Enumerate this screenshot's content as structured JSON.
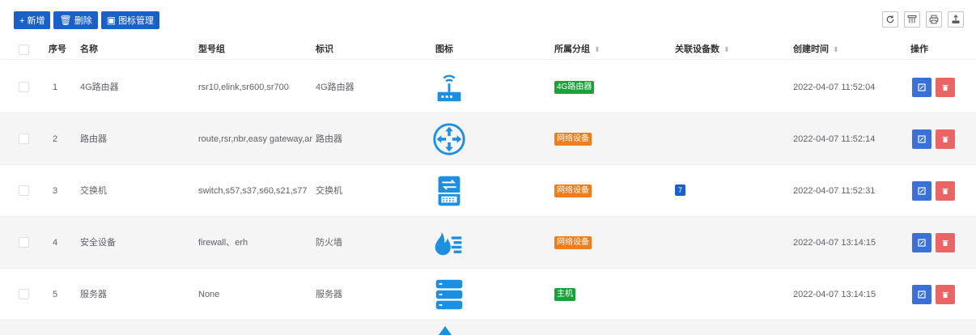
{
  "toolbar": {
    "add_label": "+ 新增",
    "delete_label": "删除",
    "icon_manage_label": "图标管理"
  },
  "table": {
    "headers": {
      "index": "序号",
      "name": "名称",
      "model_group": "型号组",
      "tag": "标识",
      "icon": "图标",
      "group": "所属分组",
      "device_count": "关联设备数",
      "created_at": "创建时间",
      "actions": "操作"
    },
    "rows": [
      {
        "index": "1",
        "name": "4G路由器",
        "model_group": "rsr10,elink,sr600,sr700",
        "tag": "4G路由器",
        "icon": "router-4g-icon",
        "group": "4G路由器",
        "group_color": "#19a23a",
        "device_count": "",
        "created_at": "2022-04-07 11:52:04"
      },
      {
        "index": "2",
        "name": "路由器",
        "model_group": "route,rsr,nbr,easy gateway,ar",
        "tag": "路由器",
        "icon": "router-icon",
        "group": "网络设备",
        "group_color": "#f07d1a",
        "device_count": "",
        "created_at": "2022-04-07 11:52:14"
      },
      {
        "index": "3",
        "name": "交换机",
        "model_group": "switch,s57,s37,s60,s21,s77",
        "tag": "交换机",
        "icon": "switch-icon",
        "group": "网络设备",
        "group_color": "#f07d1a",
        "device_count": "7",
        "created_at": "2022-04-07 11:52:31"
      },
      {
        "index": "4",
        "name": "安全设备",
        "model_group": "firewall、erh",
        "tag": "防火墙",
        "icon": "firewall-icon",
        "group": "网络设备",
        "group_color": "#f07d1a",
        "device_count": "",
        "created_at": "2022-04-07 13:14:15"
      },
      {
        "index": "5",
        "name": "服务器",
        "model_group": "None",
        "tag": "服务器",
        "icon": "server-icon",
        "group": "主机",
        "group_color": "#19a23a",
        "device_count": "",
        "created_at": "2022-04-07 13:14:15"
      }
    ]
  },
  "colors": {
    "primary": "#1b5fc8",
    "icon_blue": "#1d8fe0",
    "edit": "#3a70d8",
    "delete": "#ec6565"
  }
}
